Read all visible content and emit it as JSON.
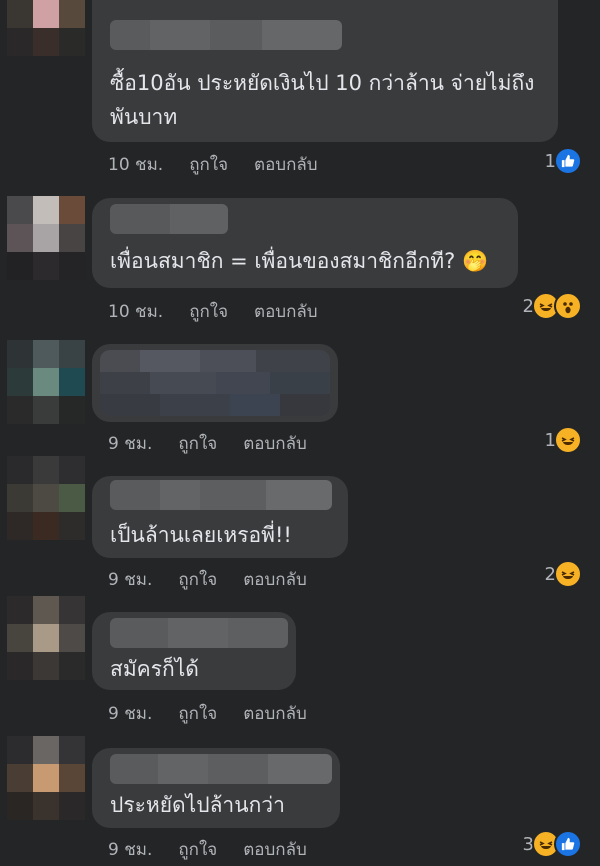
{
  "comments": [
    {
      "text": "ซื้อ10อัน ประหยัดเงินไป 10 กว่าล้าน จ่ายไม่ถึง\nพันบาท",
      "time": "10 ชม.",
      "like_label": "ถูกใจ",
      "reply_label": "ตอบกลับ",
      "reaction_count": "1",
      "reactions": [
        "like-icon"
      ]
    },
    {
      "text": "เพื่อนสมาชิก = เพื่อนของสมาชิกอีกที? 🤭",
      "time": "10 ชม.",
      "like_label": "ถูกใจ",
      "reply_label": "ตอบกลับ",
      "reaction_count": "2",
      "reactions": [
        "haha-icon",
        "wow-icon"
      ]
    },
    {
      "text": "",
      "time": "9 ชม.",
      "like_label": "ถูกใจ",
      "reply_label": "ตอบกลับ",
      "reaction_count": "1",
      "reactions": [
        "haha-icon"
      ]
    },
    {
      "text": "เป็นล้านเลยเหรอพี่!!",
      "time": "9 ชม.",
      "like_label": "ถูกใจ",
      "reply_label": "ตอบกลับ",
      "reaction_count": "2",
      "reactions": [
        "haha-icon"
      ]
    },
    {
      "text": "สมัครก็ได้",
      "time": "9 ชม.",
      "like_label": "ถูกใจ",
      "reply_label": "ตอบกลับ",
      "reaction_count": "",
      "reactions": []
    },
    {
      "text": "ประหยัดไปล้านกว่า",
      "time": "9 ชม.",
      "like_label": "ถูกใจ",
      "reply_label": "ตอบกลับ",
      "reaction_count": "3",
      "reactions": [
        "haha-icon",
        "like-icon"
      ]
    }
  ],
  "colors": {
    "background": "#242526",
    "bubble": "#3a3b3c",
    "meta_text": "#b0b3b8",
    "like_blue": "#1b74e4",
    "haha_yellow": "#f7b125"
  }
}
